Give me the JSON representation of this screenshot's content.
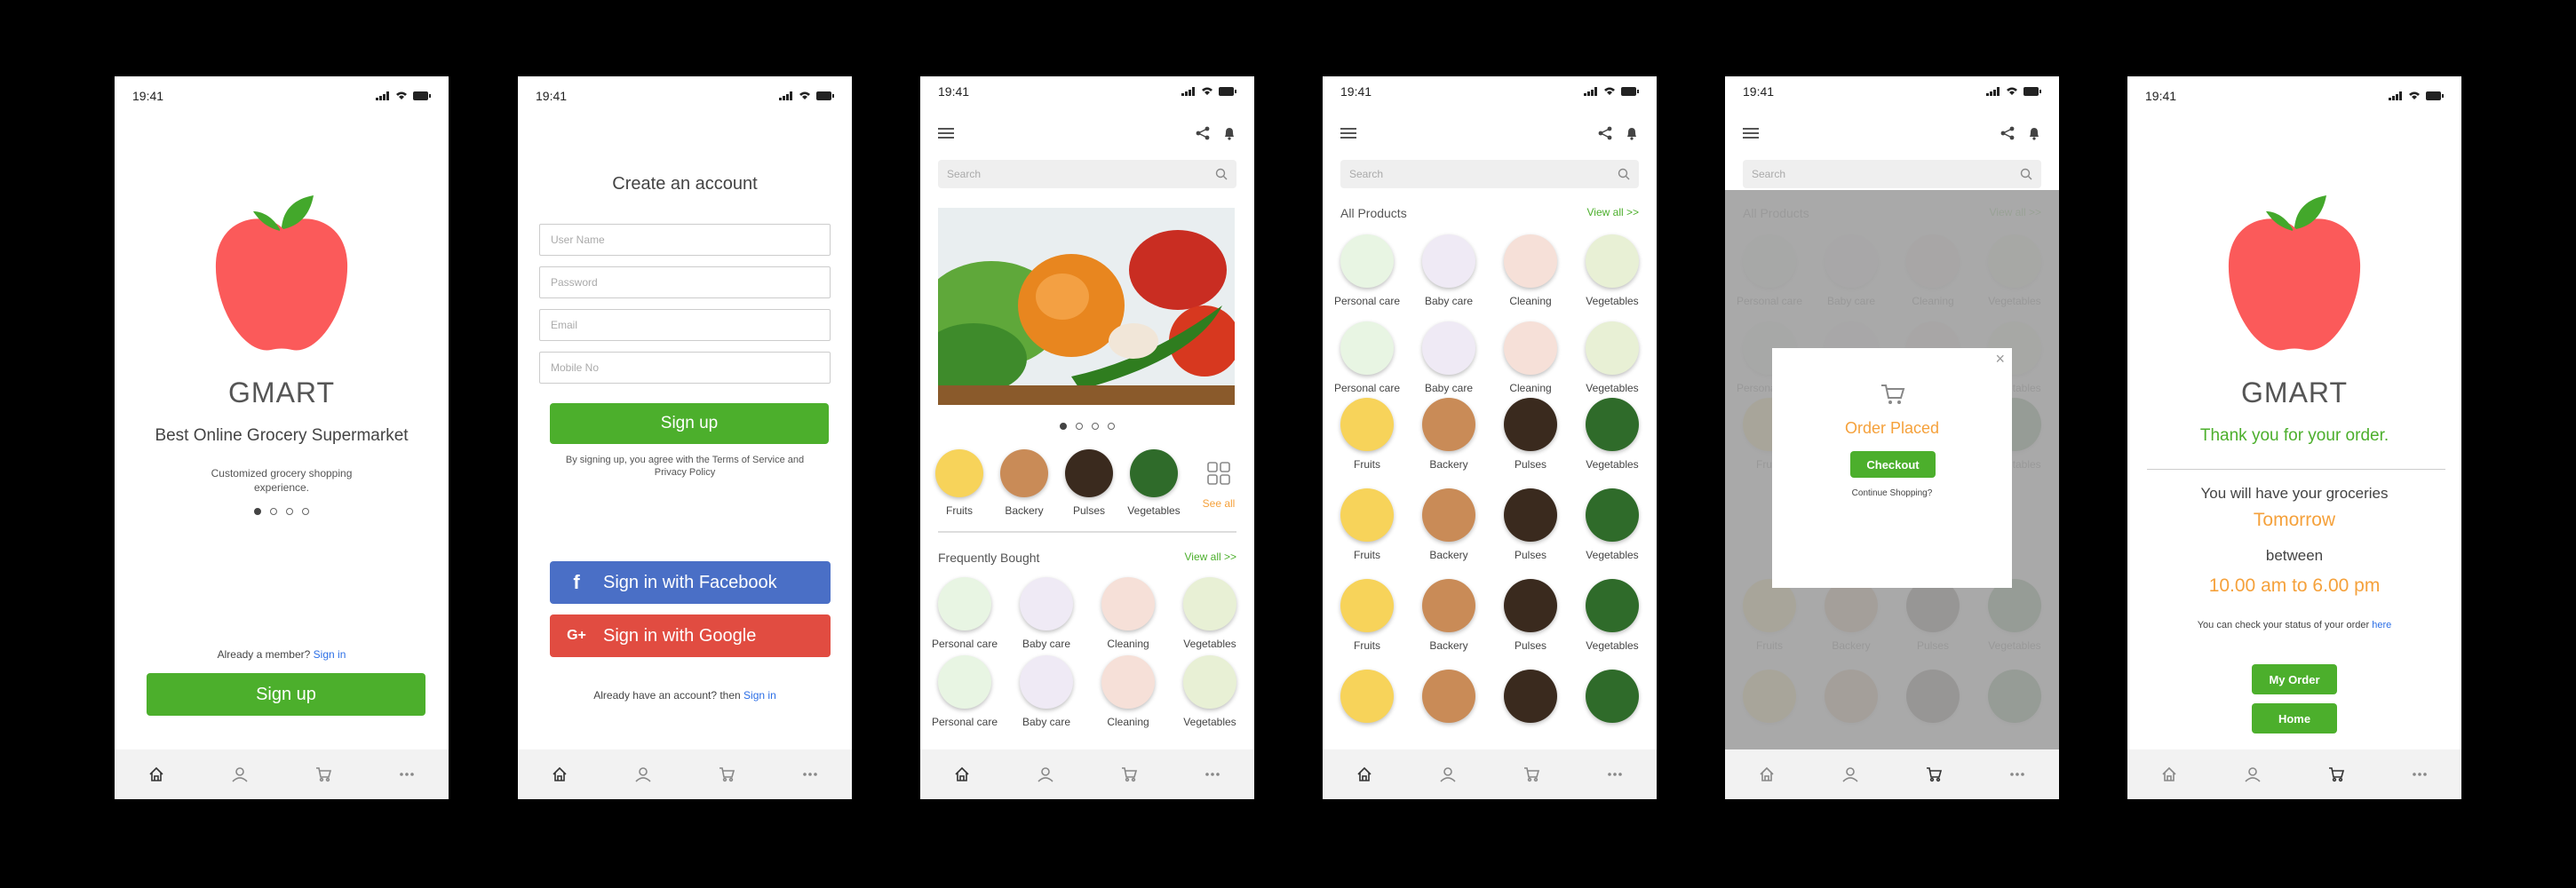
{
  "status": {
    "time": "19:41"
  },
  "splash": {
    "brand": "GMART",
    "tagline": "Best Online Grocery Supermarket",
    "sub_line1": "Customized grocery shopping",
    "sub_line2": "experience.",
    "already_member": "Already a member?",
    "sign_in": "Sign in",
    "signup_button": "Sign up"
  },
  "register": {
    "title": "Create an account",
    "username_placeholder": "User Name",
    "password_placeholder": "Password",
    "email_placeholder": "Email",
    "mobile_placeholder": "Mobile No",
    "signup_button": "Sign up",
    "terms_line1": "By signing up, you agree with the Terms of Service and",
    "terms_line2": "Privacy Policy",
    "facebook_button": "Sign in with Facebook",
    "google_button": "Sign in with Google",
    "have_account": "Already have an account? then",
    "sign_in": "Sign in"
  },
  "search": {
    "placeholder": "Search"
  },
  "home": {
    "categories": [
      "Fruits",
      "Backery",
      "Pulses",
      "Vegetables"
    ],
    "see_all": "See all",
    "frequently_bought": "Frequently Bought",
    "view_all": "View all >>",
    "freq_items": [
      "Personal care",
      "Baby care",
      "Cleaning",
      "Vegetables",
      "Personal care",
      "Baby care",
      "Cleaning",
      "Vegetables"
    ]
  },
  "products": {
    "title": "All Products",
    "view_all": "View all >>",
    "rows": [
      [
        "Personal care",
        "Baby care",
        "Cleaning",
        "Vegetables"
      ],
      [
        "Personal care",
        "Baby care",
        "Cleaning",
        "Vegetables"
      ],
      [
        "Fruits",
        "Backery",
        "Pulses",
        "Vegetables"
      ],
      [
        "Fruits",
        "Backery",
        "Pulses",
        "Vegetables"
      ],
      [
        "Fruits",
        "Backery",
        "Pulses",
        "Vegetables"
      ]
    ]
  },
  "order_modal": {
    "title": "Order Placed",
    "checkout": "Checkout",
    "continue": "Continue Shopping?"
  },
  "thanks": {
    "brand": "GMART",
    "thank_you": "Thank you for your order.",
    "line1": "You will have your groceries",
    "day": "Tomorrow",
    "between": "between",
    "time_range": "10.00 am to 6.00 pm",
    "check_status": "You can check your status of your order",
    "here": "here",
    "my_order": "My Order",
    "home": "Home"
  },
  "colors": {
    "green": "#4caf2c",
    "orange": "#f5a13b",
    "apple_red": "#fb5a5a",
    "facebook": "#4a6fc6",
    "google": "#e14c41"
  }
}
